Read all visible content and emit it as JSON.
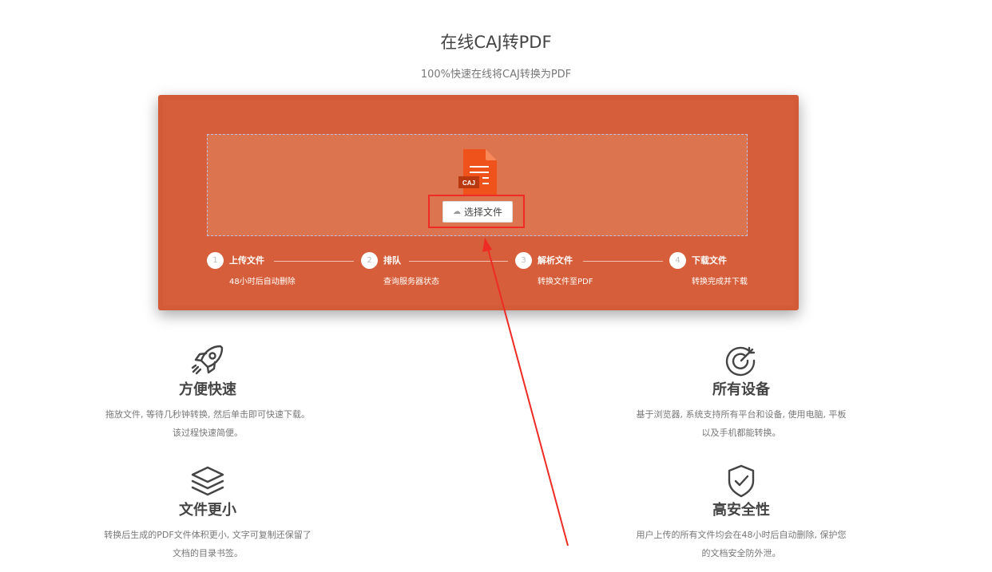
{
  "header": {
    "title": "在线CAJ转PDF",
    "subtitle": "100%快速在线将CAJ转换为PDF"
  },
  "upload": {
    "file_badge": "CAJ",
    "choose_button": "选择文件"
  },
  "steps": [
    {
      "num": "1",
      "label": "上传文件",
      "desc": "48小时后自动删除"
    },
    {
      "num": "2",
      "label": "排队",
      "desc": "查询服务器状态"
    },
    {
      "num": "3",
      "label": "解析文件",
      "desc": "转换文件至PDF"
    },
    {
      "num": "4",
      "label": "下载文件",
      "desc": "转换完成并下载"
    }
  ],
  "features": [
    {
      "name": "方便快速",
      "line1": "拖放文件, 等待几秒钟转换, 然后单击即可快速下载。",
      "line2": "该过程快速简便。",
      "icon": "rocket-icon"
    },
    {
      "name": "所有设备",
      "line1": "基于浏览器, 系统支持所有平台和设备, 使用电脑, 平板",
      "line2": "以及手机都能转换。",
      "icon": "target-icon"
    },
    {
      "name": "文件更小",
      "line1": "转换后生成的PDF文件体积更小, 文字可复制还保留了",
      "line2": "文档的目录书签。",
      "icon": "layers-icon"
    },
    {
      "name": "高安全性",
      "line1": "用户上传的所有文件均会在48小时后自动删除, 保护您",
      "line2": "的文档安全防外泄。",
      "icon": "shield-check-icon"
    }
  ],
  "colors": {
    "panel": "#d45b37",
    "dropzone": "#dc744f",
    "highlight": "#ee2b24",
    "file_icon": "#f0521b"
  }
}
